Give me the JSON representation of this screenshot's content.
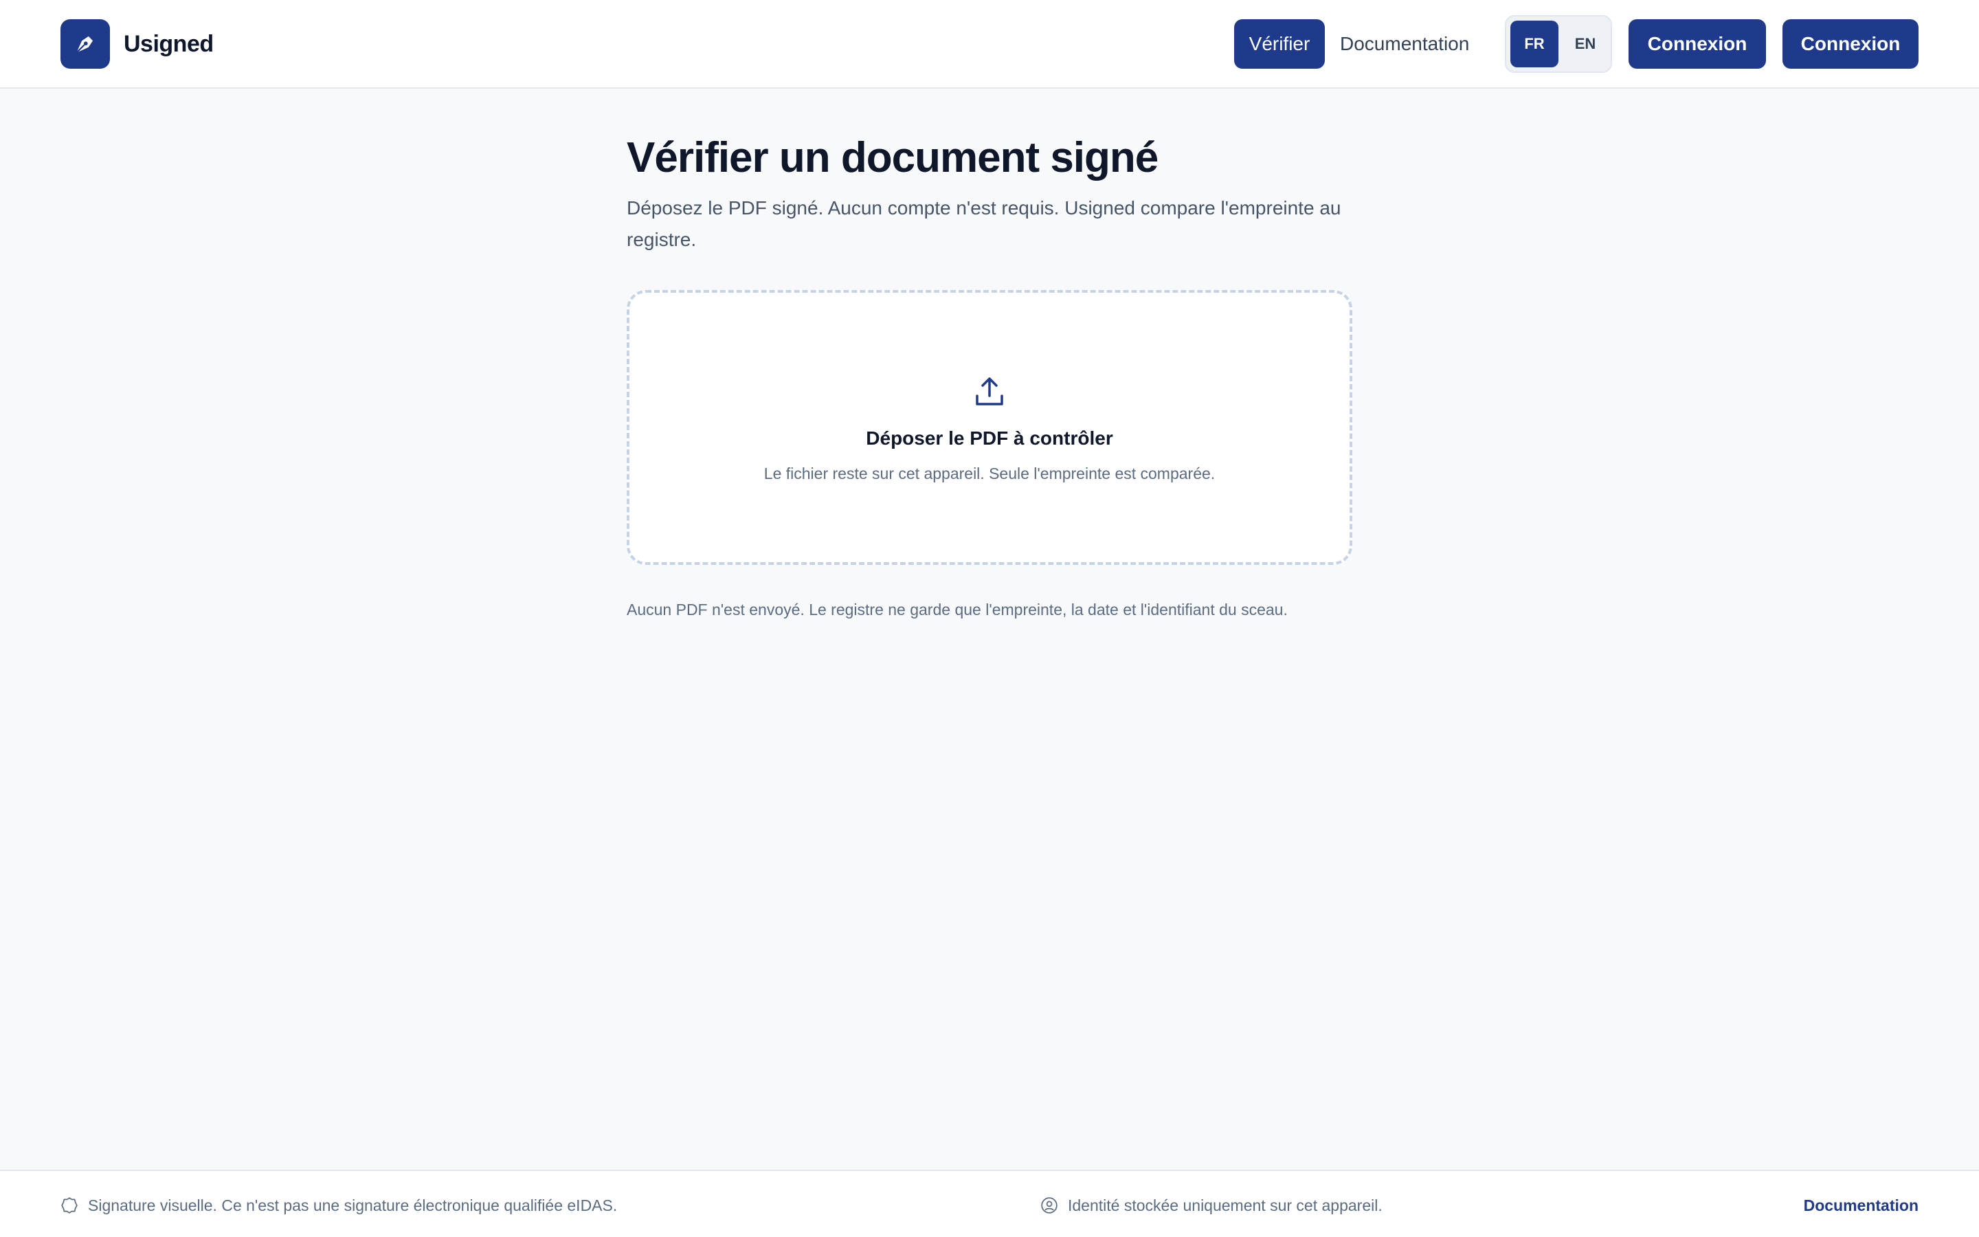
{
  "app": {
    "brand": "Usigned",
    "accent_color": "#1f3a8a"
  },
  "header": {
    "nav": {
      "verify_label": "Vérifier",
      "docs_label": "Documentation"
    },
    "lang": {
      "fr": "FR",
      "en": "EN",
      "selected": "FR"
    },
    "login_primary": "Connexion",
    "login_secondary": "Connexion"
  },
  "main": {
    "title": "Vérifier un document signé",
    "subtitle": "Déposez le PDF signé. Aucun compte n'est requis. Usigned compare l'empreinte au registre.",
    "dropzone": {
      "icon": "upload-icon",
      "title": "Déposer le PDF à contrôler",
      "hint": "Le fichier reste sur cet appareil. Seule l'empreinte est comparée."
    },
    "privacy_note": "Aucun PDF n'est envoyé. Le registre ne garde que l'empreinte, la date et l'identifiant du sceau."
  },
  "footer": {
    "left": {
      "icon": "seal-icon",
      "text": "Signature visuelle. Ce n'est pas une signature électronique qualifiée eIDAS."
    },
    "middle": {
      "icon": "user-circle-icon",
      "text": "Identité stockée uniquement sur cet appareil."
    },
    "docs_link": "Documentation"
  }
}
